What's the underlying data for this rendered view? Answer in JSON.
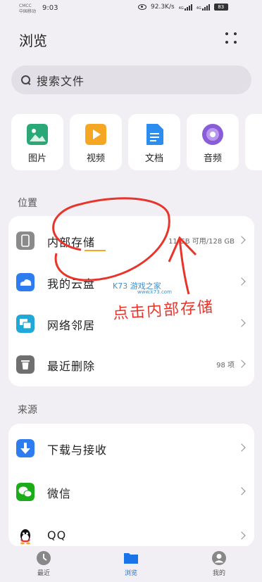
{
  "status_bar": {
    "carrier_top": "CMCC",
    "carrier_bottom": "中国移动",
    "time": "9:03",
    "net_speed": "92.3K/s",
    "signal_label_1": "4G",
    "signal_label_2": "4G",
    "battery": "83"
  },
  "header": {
    "title": "浏览"
  },
  "search": {
    "placeholder": "搜索文件"
  },
  "categories": [
    {
      "label": "图片",
      "icon": "image-icon",
      "color": "#2aa876"
    },
    {
      "label": "视频",
      "icon": "video-icon",
      "color": "#f5a623"
    },
    {
      "label": "文档",
      "icon": "document-icon",
      "color": "#2d8cf0"
    },
    {
      "label": "音频",
      "icon": "audio-icon",
      "color": "#8a5cd8"
    }
  ],
  "location": {
    "section_title": "位置",
    "items": [
      {
        "label": "内部存储",
        "meta": "11 GB 可用/128 GB",
        "icon": "phone-storage-icon"
      },
      {
        "label": "我的云盘",
        "meta": "",
        "icon": "cloud-icon"
      },
      {
        "label": "网络邻居",
        "meta": "",
        "icon": "network-icon"
      },
      {
        "label": "最近删除",
        "meta": "98 项",
        "icon": "trash-icon"
      }
    ]
  },
  "sources": {
    "section_title": "来源",
    "items": [
      {
        "label": "下载与接收",
        "icon": "download-icon"
      },
      {
        "label": "微信",
        "icon": "wechat-icon"
      },
      {
        "label": "QQ",
        "icon": "qq-icon"
      }
    ]
  },
  "tabs": [
    {
      "label": "最近",
      "icon": "clock-icon"
    },
    {
      "label": "浏览",
      "icon": "folder-icon",
      "active": true
    },
    {
      "label": "我的",
      "icon": "profile-icon"
    }
  ],
  "annotation": {
    "text": "点击内部存储"
  },
  "watermark": {
    "text": "K73 游戏之家",
    "url": "www.k73.com"
  },
  "colors": {
    "accent": "#1a73e8",
    "annotation": "#e8352c"
  }
}
